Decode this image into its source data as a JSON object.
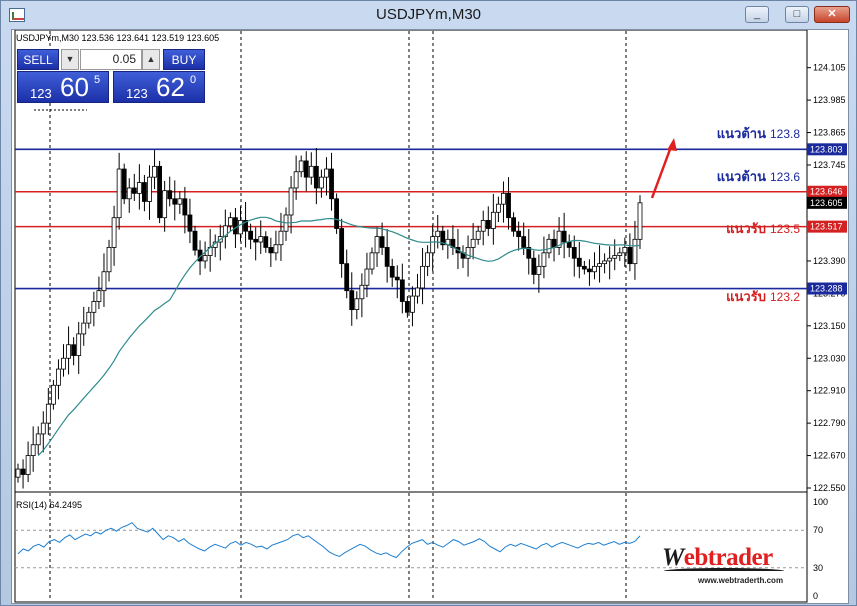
{
  "window": {
    "title": "USDJPYm,M30",
    "buttons": {
      "minimize": "_",
      "maximize": "□",
      "close": "✕"
    }
  },
  "trade_panel": {
    "sell_label": "SELL",
    "buy_label": "BUY",
    "lot_value": "0.05",
    "sell_quote": {
      "prefix": "123",
      "big": "60",
      "sup": "5"
    },
    "buy_quote": {
      "prefix": "123",
      "big": "62",
      "sup": "0"
    }
  },
  "header": {
    "symbol_info": "USDJPYm,M30  123.536 123.641 123.519 123.605"
  },
  "rsi_panel": {
    "label": "RSI(14) 64.2495"
  },
  "annotations": {
    "r1": {
      "text": "แนวต้าน",
      "value": "123.8"
    },
    "r2": {
      "text": "แนวต้าน",
      "value": "123.6"
    },
    "s1": {
      "text": "แนวรับ",
      "value": "123.5"
    },
    "s2": {
      "text": "แนวรับ",
      "value": "123.2"
    }
  },
  "logo": {
    "text_w": "W",
    "text_rest": "ebtrader",
    "url": "www.webtraderth.com"
  },
  "colors": {
    "bull": "#ffffff",
    "bear": "#000000",
    "ma": "#2e8b8b",
    "rsi": "#1e7fd0",
    "resistance": "#1a2a9c",
    "support": "#d42020",
    "current_price_bg": "#000000"
  },
  "chart_data": {
    "type": "candlestick",
    "symbol": "USDJPYm",
    "timeframe": "M30",
    "ylim": [
      122.55,
      124.2
    ],
    "price_ticks": [
      124.105,
      123.985,
      123.865,
      123.745,
      123.625,
      123.51,
      123.39,
      123.27,
      123.15,
      123.03,
      122.91,
      122.79,
      122.67,
      122.55
    ],
    "price_tick_labels": [
      "124.105",
      "123.985",
      "123.865",
      "123.745",
      "123.625",
      "123.510",
      "123.390",
      "123.270",
      "123.150",
      "123.030",
      "122.910",
      "122.790",
      "122.670",
      "122.550"
    ],
    "horizontal_lines": [
      {
        "price": 123.803,
        "label": "123.803",
        "color": "#1a2a9c"
      },
      {
        "price": 123.646,
        "label": "123.646",
        "color": "#d42020"
      },
      {
        "price": 123.517,
        "label": "123.517",
        "color": "#d42020"
      },
      {
        "price": 123.288,
        "label": "123.288",
        "color": "#1a2a9c"
      }
    ],
    "current_price": {
      "price": 123.605,
      "label": "123.605"
    },
    "closes": [
      122.62,
      122.6,
      122.67,
      122.71,
      122.75,
      122.79,
      122.86,
      122.93,
      122.99,
      123.03,
      123.08,
      123.04,
      123.12,
      123.16,
      123.2,
      123.24,
      123.28,
      123.35,
      123.44,
      123.55,
      123.73,
      123.62,
      123.66,
      123.64,
      123.68,
      123.61,
      123.7,
      123.74,
      123.55,
      123.65,
      123.62,
      123.6,
      123.62,
      123.56,
      123.5,
      123.43,
      123.39,
      123.41,
      123.44,
      123.46,
      123.48,
      123.52,
      123.55,
      123.49,
      123.54,
      123.5,
      123.47,
      123.46,
      123.48,
      123.44,
      123.42,
      123.45,
      123.5,
      123.56,
      123.66,
      123.72,
      123.76,
      123.7,
      123.74,
      123.66,
      123.7,
      123.73,
      123.62,
      123.51,
      123.38,
      123.28,
      123.21,
      123.25,
      123.3,
      123.36,
      123.42,
      123.48,
      123.44,
      123.37,
      123.33,
      123.32,
      123.24,
      123.2,
      123.26,
      123.29,
      123.37,
      123.42,
      123.48,
      123.5,
      123.45,
      123.47,
      123.44,
      123.42,
      123.4,
      123.44,
      123.47,
      123.5,
      123.54,
      123.51,
      123.57,
      123.6,
      123.64,
      123.55,
      123.5,
      123.48,
      123.44,
      123.4,
      123.34,
      123.37,
      123.42,
      123.47,
      123.44,
      123.5,
      123.46,
      123.44,
      123.4,
      123.37,
      123.36,
      123.35,
      123.37,
      123.38,
      123.39,
      123.4,
      123.41,
      123.42,
      123.44,
      123.38,
      123.47,
      123.605
    ],
    "ma_label": "Moving Average",
    "rsi": {
      "period": 14,
      "value": 64.2495,
      "ylim": [
        0,
        100
      ],
      "levels": [
        70,
        30
      ],
      "tick_labels": [
        "100",
        "70",
        "30",
        "0"
      ],
      "values": [
        45,
        50,
        48,
        53,
        55,
        52,
        58,
        60,
        57,
        62,
        65,
        60,
        63,
        66,
        64,
        68,
        66,
        70,
        72,
        69,
        73,
        75,
        78,
        72,
        70,
        68,
        72,
        66,
        60,
        64,
        62,
        58,
        61,
        56,
        53,
        50,
        48,
        52,
        55,
        53,
        51,
        56,
        58,
        54,
        57,
        55,
        52,
        53,
        50,
        54,
        56,
        58,
        60,
        64,
        66,
        62,
        64,
        60,
        56,
        52,
        47,
        44,
        42,
        46,
        49,
        52,
        55,
        53,
        49,
        46,
        44,
        46,
        43,
        41,
        47,
        52,
        56,
        58,
        60,
        55,
        57,
        54,
        52,
        56,
        60,
        58,
        54,
        56,
        58,
        61,
        58,
        53,
        50,
        47,
        52,
        55,
        53,
        56,
        54,
        52,
        50,
        54,
        56,
        52,
        55,
        57,
        55,
        53,
        51,
        54,
        56,
        55,
        57,
        54,
        56,
        58,
        55,
        57,
        56,
        58,
        64
      ]
    },
    "vertical_separators_note": "session separators"
  }
}
